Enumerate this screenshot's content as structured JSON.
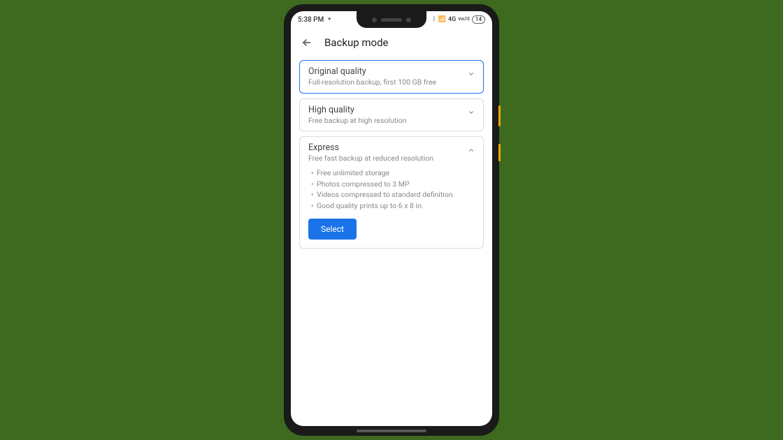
{
  "status": {
    "time": "5:38 PM",
    "network": "4G",
    "lte": "VoLTE",
    "battery": "14"
  },
  "header": {
    "title": "Backup mode"
  },
  "options": {
    "original": {
      "title": "Original quality",
      "sub": "Full-resolution backup, first 100 GB free"
    },
    "high": {
      "title": "High quality",
      "sub": "Free backup at high resolution"
    },
    "express": {
      "title": "Express",
      "sub": "Free fast backup at reduced resolution",
      "bullets": {
        "b1": "Free unlimited storage",
        "b2": "Photos compressed to 3 MP",
        "b3": "Videos compressed to standard definition",
        "b4": "Good quality prints up to 6 x 8 in."
      },
      "select_label": "Select"
    }
  }
}
